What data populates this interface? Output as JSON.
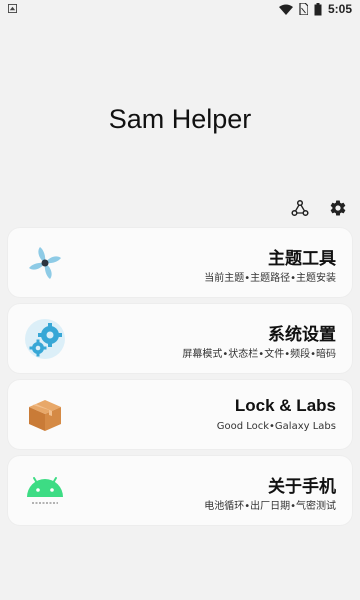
{
  "status_bar": {
    "time": "5:05",
    "icons": [
      "notification-icon",
      "wifi-icon",
      "sim-card-icon",
      "battery-icon"
    ]
  },
  "app": {
    "title": "Sam Helper"
  },
  "toolbar": {
    "icons": [
      "share-nodes-icon",
      "settings-gear-icon"
    ]
  },
  "cards": [
    {
      "title": "主题工具",
      "subtitle": "当前主题•主题路径•主题安装",
      "icon": "fan-icon"
    },
    {
      "title": "系统设置",
      "subtitle": "屏幕模式•状态栏•文件•频段•暗码",
      "icon": "gears-icon"
    },
    {
      "title": "Lock & Labs",
      "subtitle": "Good Lock•Galaxy Labs",
      "icon": "box-icon"
    },
    {
      "title": "关于手机",
      "subtitle": "电池循环•出厂日期•气密测试",
      "icon": "android-icon"
    }
  ],
  "colors": {
    "background": "#f2f2f2",
    "card": "#fbfbfb",
    "fan_blue": "#8ecbe6",
    "gear_blue": "#37a7d6",
    "box_orange": "#d58a45",
    "android_green": "#3ddc84"
  }
}
